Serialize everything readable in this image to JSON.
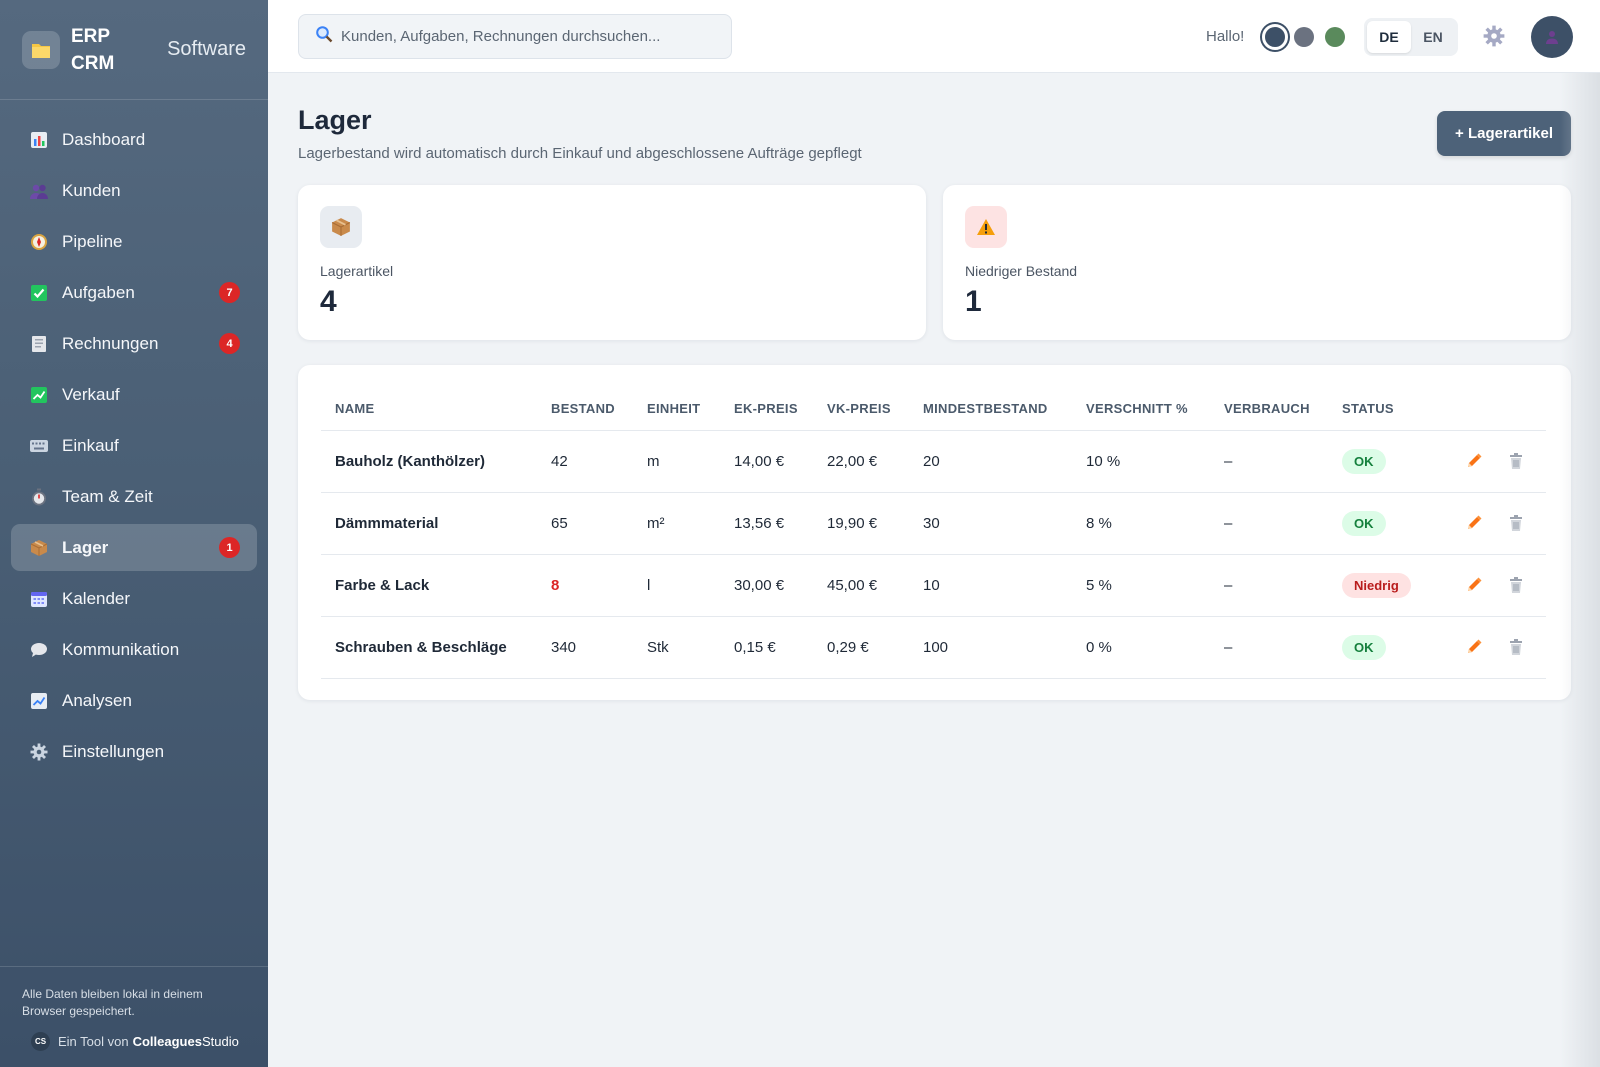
{
  "brand": {
    "name": "ERP CRM",
    "subtitle": "Software"
  },
  "sidebar": {
    "items": [
      {
        "label": "Dashboard",
        "icon": "bar-chart-icon"
      },
      {
        "label": "Kunden",
        "icon": "people-icon"
      },
      {
        "label": "Pipeline",
        "icon": "compass-icon"
      },
      {
        "label": "Aufgaben",
        "icon": "checkbox-icon",
        "badge": "7"
      },
      {
        "label": "Rechnungen",
        "icon": "receipt-icon",
        "badge": "4"
      },
      {
        "label": "Verkauf",
        "icon": "chart-up-icon"
      },
      {
        "label": "Einkauf",
        "icon": "keyboard-icon"
      },
      {
        "label": "Team & Zeit",
        "icon": "stopwatch-icon"
      },
      {
        "label": "Lager",
        "icon": "package-icon",
        "badge": "1",
        "active": true
      },
      {
        "label": "Kalender",
        "icon": "calendar-icon"
      },
      {
        "label": "Kommunikation",
        "icon": "speech-bubble-icon"
      },
      {
        "label": "Analysen",
        "icon": "line-chart-icon"
      },
      {
        "label": "Einstellungen",
        "icon": "gear-icon"
      }
    ],
    "footer_note": "Alle Daten bleiben lokal in deinem Browser gespeichert.",
    "credit_prefix": "Ein Tool von",
    "credit_brand_bold": "Colleagues",
    "credit_brand_rest": "Studio",
    "credit_logo": "CS"
  },
  "topbar": {
    "search_placeholder": "Kunden, Aufgaben, Rechnungen durchsuchen...",
    "greeting": "Hallo!",
    "theme_colors": [
      "#3d5067",
      "#6b7280",
      "#5a8a5c"
    ],
    "languages": [
      "DE",
      "EN"
    ],
    "active_language": "DE"
  },
  "page": {
    "title": "Lager",
    "subtitle": "Lagerbestand wird automatisch durch Einkauf und abgeschlossene Aufträge gepflegt",
    "add_button": "+ Lagerartikel"
  },
  "stats": [
    {
      "label": "Lagerartikel",
      "value": "4",
      "icon": "package-icon"
    },
    {
      "label": "Niedriger Bestand",
      "value": "1",
      "icon": "warning-icon"
    }
  ],
  "table": {
    "columns": [
      "NAME",
      "BESTAND",
      "EINHEIT",
      "EK-PREIS",
      "VK-PREIS",
      "MINDESTBESTAND",
      "VERSCHNITT %",
      "VERBRAUCH",
      "STATUS"
    ],
    "rows": [
      {
        "name": "Bauholz (Kanthölzer)",
        "bestand": "42",
        "einheit": "m",
        "ek": "14,00 €",
        "vk": "22,00 €",
        "min": "20",
        "verschnitt": "10 %",
        "verbrauch": "–",
        "status": "OK",
        "low": false
      },
      {
        "name": "Dämmmaterial",
        "bestand": "65",
        "einheit": "m²",
        "ek": "13,56 €",
        "vk": "19,90 €",
        "min": "30",
        "verschnitt": "8 %",
        "verbrauch": "–",
        "status": "OK",
        "low": false
      },
      {
        "name": "Farbe & Lack",
        "bestand": "8",
        "einheit": "l",
        "ek": "30,00 €",
        "vk": "45,00 €",
        "min": "10",
        "verschnitt": "5 %",
        "verbrauch": "–",
        "status": "Niedrig",
        "low": true
      },
      {
        "name": "Schrauben & Beschläge",
        "bestand": "340",
        "einheit": "Stk",
        "ek": "0,15 €",
        "vk": "0,29 €",
        "min": "100",
        "verschnitt": "0 %",
        "verbrauch": "–",
        "status": "OK",
        "low": false
      }
    ],
    "row_actions": [
      "pencil-icon",
      "trash-icon"
    ]
  }
}
